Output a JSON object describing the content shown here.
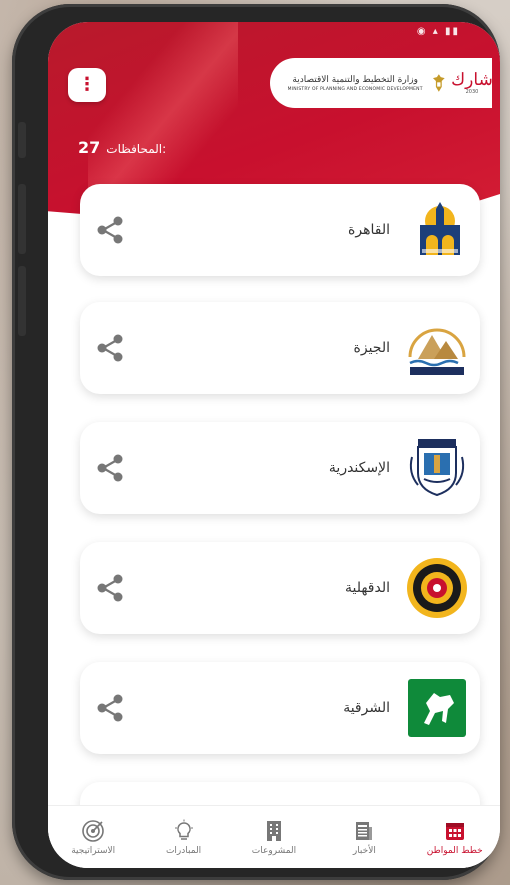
{
  "header": {
    "ministry_name_ar": "وزارة التخطيط والتنمية الاقتصادية",
    "ministry_name_en": "MINISTRY OF PLANNING AND ECONOMIC DEVELOPMENT",
    "app_logo_ar": "شارك",
    "app_logo_year": "2030",
    "governorates_label": "المحافظات:",
    "governorates_count": "27"
  },
  "governorates": [
    {
      "name": "القاهرة",
      "emblem": "cairo-emblem"
    },
    {
      "name": "الجيزة",
      "emblem": "giza-emblem"
    },
    {
      "name": "الإسكندرية",
      "emblem": "alexandria-emblem"
    },
    {
      "name": "الدقهلية",
      "emblem": "dakahlia-emblem"
    },
    {
      "name": "الشرقية",
      "emblem": "sharqia-emblem"
    }
  ],
  "nav": [
    {
      "label": "خطط المواطن",
      "icon": "calendar-icon",
      "active": true
    },
    {
      "label": "الأخبار",
      "icon": "newspaper-icon",
      "active": false
    },
    {
      "label": "المشروعات",
      "icon": "building-icon",
      "active": false
    },
    {
      "label": "المبادرات",
      "icon": "lightbulb-icon",
      "active": false
    },
    {
      "label": "الاستراتيجية",
      "icon": "target-icon",
      "active": false
    }
  ],
  "colors": {
    "brand": "#c8102e",
    "card": "#ffffff",
    "text": "#333333"
  }
}
